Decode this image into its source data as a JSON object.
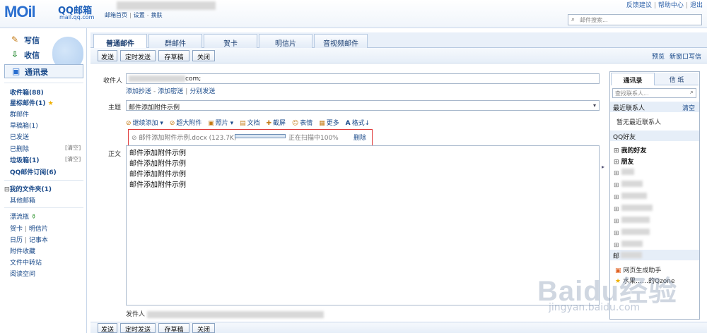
{
  "header": {
    "logo_text": "MOil",
    "logo_cn": "QQ邮箱",
    "logo_url": "mail.qq.com",
    "nav": [
      "邮箱首页",
      "设置",
      "换肤"
    ],
    "links": [
      "反馈建议",
      "帮助中心",
      "退出"
    ],
    "search_placeholder": "邮件搜索..."
  },
  "sidebar": {
    "compose": "写信",
    "receive": "收信",
    "contacts": "通讯录",
    "folders": [
      {
        "label": "收件箱(88)",
        "bold": true
      },
      {
        "label": "星标邮件(1)",
        "bold": true,
        "star": "★"
      },
      {
        "label": "群邮件",
        "bold": false
      },
      {
        "label": "草稿箱(1)",
        "bold": false
      },
      {
        "label": "已发送",
        "bold": false
      },
      {
        "label": "已删除",
        "bold": false,
        "clear": "[清空]"
      },
      {
        "label": "垃圾箱(1)",
        "bold": true,
        "clear": "[清空]"
      },
      {
        "label": "QQ邮件订阅(6)",
        "bold": true
      }
    ],
    "my_folders": "我的文件夹(1)",
    "other_mailbox": "其他邮箱",
    "extras": [
      "漂流瓶",
      "贺卡",
      "明信片",
      "日历",
      "记事本",
      "附件收藏",
      "文件中转站",
      "阅读空间"
    ]
  },
  "tabs": [
    "普通邮件",
    "群邮件",
    "贺卡",
    "明信片",
    "音视频邮件"
  ],
  "toolbar": {
    "send": "发送",
    "scheduled_send": "定时发送",
    "save_draft": "存草稿",
    "close": "关闭",
    "preview": "预览",
    "new_window": "新窗口写信"
  },
  "compose": {
    "to_label": "收件人",
    "to_value_suffix": "com;",
    "to_links": [
      "添加抄送",
      "添加密送",
      "分别发送"
    ],
    "subject_label": "主题",
    "subject_value": "邮件添加附件示例",
    "subject_arrow": "▾",
    "edit_tools": [
      {
        "icon": "paperclip-icon",
        "glyph": "⊘",
        "label": "继续添加",
        "dropdown": true
      },
      {
        "icon": "super-attach-icon",
        "glyph": "⊘",
        "label": "超大附件"
      },
      {
        "icon": "photo-icon",
        "glyph": "▣",
        "label": "照片",
        "dropdown": true
      },
      {
        "icon": "doc-icon",
        "glyph": "▤",
        "label": "文档"
      },
      {
        "icon": "screenshot-icon",
        "glyph": "✚",
        "label": "截屏"
      },
      {
        "icon": "emoji-icon",
        "glyph": "☺",
        "label": "表情"
      },
      {
        "icon": "more-icon",
        "glyph": "▦",
        "label": "更多"
      },
      {
        "icon": "format-icon",
        "glyph": "A",
        "label": "格式↓"
      }
    ],
    "attachment": {
      "name": "邮件添加附件示例.docx (123.7K)",
      "progress": 1.0,
      "status": "正在扫描中100%",
      "delete": "删除"
    },
    "body_label": "正文",
    "body_lines": [
      "邮件添加附件示例",
      "邮件添加附件示例",
      "邮件添加附件示例",
      "邮件添加附件示例"
    ],
    "sender_label": "发件人"
  },
  "right_panel": {
    "tabs": [
      "通讯录",
      "信 纸"
    ],
    "search_placeholder": "查找联系人...",
    "recent_header": "最近联系人",
    "recent_clear": "清空",
    "recent_empty": "暂无最近联系人",
    "qq_header": "QQ好友",
    "groups": [
      "我的好友",
      "朋友"
    ],
    "mail_header": "邮",
    "tools": [
      "网页生成助手",
      "水果……的Qzone"
    ]
  },
  "watermark": {
    "text": "Baidu经验",
    "url": "jingyan.baidu.com"
  }
}
